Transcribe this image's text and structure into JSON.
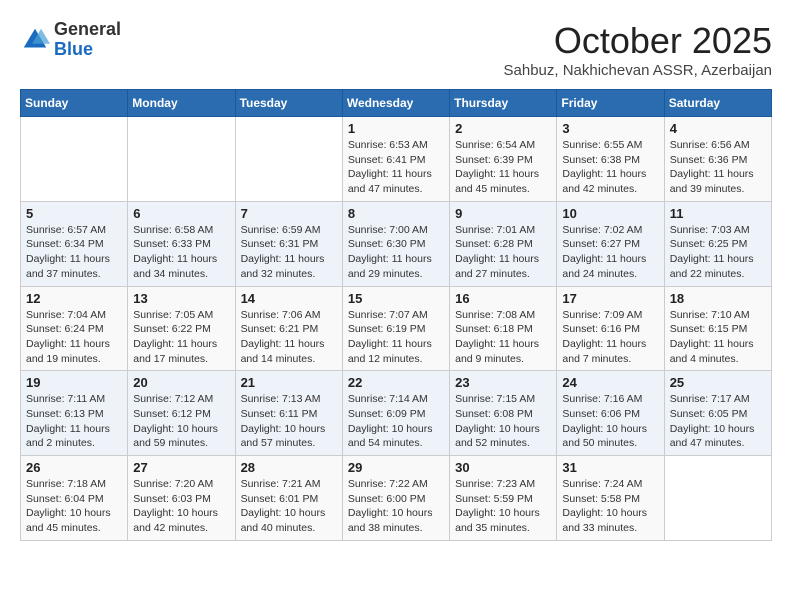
{
  "logo": {
    "general": "General",
    "blue": "Blue"
  },
  "header": {
    "month": "October 2025",
    "location": "Sahbuz, Nakhichevan ASSR, Azerbaijan"
  },
  "weekdays": [
    "Sunday",
    "Monday",
    "Tuesday",
    "Wednesday",
    "Thursday",
    "Friday",
    "Saturday"
  ],
  "weeks": [
    [
      {
        "day": "",
        "info": ""
      },
      {
        "day": "",
        "info": ""
      },
      {
        "day": "",
        "info": ""
      },
      {
        "day": "1",
        "info": "Sunrise: 6:53 AM\nSunset: 6:41 PM\nDaylight: 11 hours\nand 47 minutes."
      },
      {
        "day": "2",
        "info": "Sunrise: 6:54 AM\nSunset: 6:39 PM\nDaylight: 11 hours\nand 45 minutes."
      },
      {
        "day": "3",
        "info": "Sunrise: 6:55 AM\nSunset: 6:38 PM\nDaylight: 11 hours\nand 42 minutes."
      },
      {
        "day": "4",
        "info": "Sunrise: 6:56 AM\nSunset: 6:36 PM\nDaylight: 11 hours\nand 39 minutes."
      }
    ],
    [
      {
        "day": "5",
        "info": "Sunrise: 6:57 AM\nSunset: 6:34 PM\nDaylight: 11 hours\nand 37 minutes."
      },
      {
        "day": "6",
        "info": "Sunrise: 6:58 AM\nSunset: 6:33 PM\nDaylight: 11 hours\nand 34 minutes."
      },
      {
        "day": "7",
        "info": "Sunrise: 6:59 AM\nSunset: 6:31 PM\nDaylight: 11 hours\nand 32 minutes."
      },
      {
        "day": "8",
        "info": "Sunrise: 7:00 AM\nSunset: 6:30 PM\nDaylight: 11 hours\nand 29 minutes."
      },
      {
        "day": "9",
        "info": "Sunrise: 7:01 AM\nSunset: 6:28 PM\nDaylight: 11 hours\nand 27 minutes."
      },
      {
        "day": "10",
        "info": "Sunrise: 7:02 AM\nSunset: 6:27 PM\nDaylight: 11 hours\nand 24 minutes."
      },
      {
        "day": "11",
        "info": "Sunrise: 7:03 AM\nSunset: 6:25 PM\nDaylight: 11 hours\nand 22 minutes."
      }
    ],
    [
      {
        "day": "12",
        "info": "Sunrise: 7:04 AM\nSunset: 6:24 PM\nDaylight: 11 hours\nand 19 minutes."
      },
      {
        "day": "13",
        "info": "Sunrise: 7:05 AM\nSunset: 6:22 PM\nDaylight: 11 hours\nand 17 minutes."
      },
      {
        "day": "14",
        "info": "Sunrise: 7:06 AM\nSunset: 6:21 PM\nDaylight: 11 hours\nand 14 minutes."
      },
      {
        "day": "15",
        "info": "Sunrise: 7:07 AM\nSunset: 6:19 PM\nDaylight: 11 hours\nand 12 minutes."
      },
      {
        "day": "16",
        "info": "Sunrise: 7:08 AM\nSunset: 6:18 PM\nDaylight: 11 hours\nand 9 minutes."
      },
      {
        "day": "17",
        "info": "Sunrise: 7:09 AM\nSunset: 6:16 PM\nDaylight: 11 hours\nand 7 minutes."
      },
      {
        "day": "18",
        "info": "Sunrise: 7:10 AM\nSunset: 6:15 PM\nDaylight: 11 hours\nand 4 minutes."
      }
    ],
    [
      {
        "day": "19",
        "info": "Sunrise: 7:11 AM\nSunset: 6:13 PM\nDaylight: 11 hours\nand 2 minutes."
      },
      {
        "day": "20",
        "info": "Sunrise: 7:12 AM\nSunset: 6:12 PM\nDaylight: 10 hours\nand 59 minutes."
      },
      {
        "day": "21",
        "info": "Sunrise: 7:13 AM\nSunset: 6:11 PM\nDaylight: 10 hours\nand 57 minutes."
      },
      {
        "day": "22",
        "info": "Sunrise: 7:14 AM\nSunset: 6:09 PM\nDaylight: 10 hours\nand 54 minutes."
      },
      {
        "day": "23",
        "info": "Sunrise: 7:15 AM\nSunset: 6:08 PM\nDaylight: 10 hours\nand 52 minutes."
      },
      {
        "day": "24",
        "info": "Sunrise: 7:16 AM\nSunset: 6:06 PM\nDaylight: 10 hours\nand 50 minutes."
      },
      {
        "day": "25",
        "info": "Sunrise: 7:17 AM\nSunset: 6:05 PM\nDaylight: 10 hours\nand 47 minutes."
      }
    ],
    [
      {
        "day": "26",
        "info": "Sunrise: 7:18 AM\nSunset: 6:04 PM\nDaylight: 10 hours\nand 45 minutes."
      },
      {
        "day": "27",
        "info": "Sunrise: 7:20 AM\nSunset: 6:03 PM\nDaylight: 10 hours\nand 42 minutes."
      },
      {
        "day": "28",
        "info": "Sunrise: 7:21 AM\nSunset: 6:01 PM\nDaylight: 10 hours\nand 40 minutes."
      },
      {
        "day": "29",
        "info": "Sunrise: 7:22 AM\nSunset: 6:00 PM\nDaylight: 10 hours\nand 38 minutes."
      },
      {
        "day": "30",
        "info": "Sunrise: 7:23 AM\nSunset: 5:59 PM\nDaylight: 10 hours\nand 35 minutes."
      },
      {
        "day": "31",
        "info": "Sunrise: 7:24 AM\nSunset: 5:58 PM\nDaylight: 10 hours\nand 33 minutes."
      },
      {
        "day": "",
        "info": ""
      }
    ]
  ]
}
